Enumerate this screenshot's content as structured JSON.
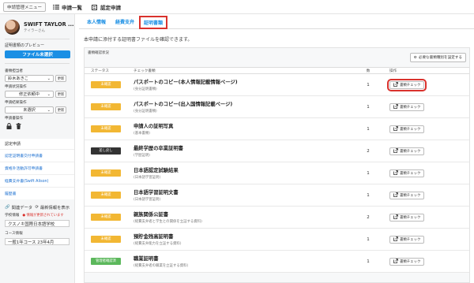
{
  "topbar": {
    "menu_button": "申請管理メニュー",
    "nav": [
      "申請一覧",
      "認定申請"
    ]
  },
  "sidebar": {
    "profile": {
      "name": "SWIFT TAYLOR ...",
      "subname": "テイラーさん"
    },
    "preview_title": "証明書類のプレビュー",
    "file_select_button": "ファイル未選択",
    "fields": [
      {
        "label": "書類担当者",
        "value": "鈴木あきこ",
        "update": "更新"
      },
      {
        "label": "申請状況操作",
        "value": "修正依頼中",
        "update": "更新"
      },
      {
        "label": "申請結果操作",
        "value": "未選択",
        "update": "更新"
      }
    ],
    "doc_ops_label": "申請書操作",
    "links_header": "認定申請",
    "links": [
      "認定証明書交付申請書",
      "資格外活動許可申請書",
      "経費支弁書(Swift Alison)",
      "履歴書"
    ],
    "actions": {
      "related": "関連データ",
      "latest_info": "最新情報を表示"
    },
    "school": {
      "label": "学校情報",
      "notice": "情報が更新されています",
      "value": "クスノキ国際日本語学校"
    },
    "course": {
      "label": "コース情報",
      "value": "一般1年コース 23年4月"
    }
  },
  "main": {
    "tabs": [
      "本人情報",
      "経費支弁",
      "証明書類"
    ],
    "active_tab": 2,
    "description": "本申請に添付する証明書ファイルを確認できます。",
    "panel_title": "書類確認状況",
    "settings_button": "必要な書類種別を設定する",
    "table": {
      "headers": [
        "ステータス",
        "チェック書類",
        "数",
        "操作"
      ],
      "check_label": "書類チェック",
      "rows": [
        {
          "status": "未確認",
          "status_color": "#f2b733",
          "title": "パスポートのコピー(本人情報記載情報ページ)",
          "sub": "(身分証明書類)",
          "count": "1"
        },
        {
          "status": "未確認",
          "status_color": "#f2b733",
          "title": "パスポートのコピー(出入国情報記載ページ)",
          "sub": "(身分証明書類)",
          "count": "1"
        },
        {
          "status": "未確認",
          "status_color": "#f2b733",
          "title": "申請人の証明写真",
          "sub": "(基本書類)",
          "count": "1"
        },
        {
          "status": "差し戻し",
          "status_color": "#333333",
          "title": "最終学歴の卒業証明書",
          "sub": "(学歴証明)",
          "count": "2"
        },
        {
          "status": "未確認",
          "status_color": "#f2b733",
          "title": "日本語認定試験結果",
          "sub": "(日本語学習証明)",
          "count": "1"
        },
        {
          "status": "未確認",
          "status_color": "#f2b733",
          "title": "日本語学習証明文書",
          "sub": "(日本語学習証明)",
          "count": "1"
        },
        {
          "status": "未確認",
          "status_color": "#f2b733",
          "title": "親族関係公証書",
          "sub": "(経費支弁者と学生との関係を立証する資料)",
          "count": "2"
        },
        {
          "status": "未確認",
          "status_color": "#f2b733",
          "title": "預貯金残高証明書",
          "sub": "(経費支弁能力を立証する資料)",
          "count": "1"
        },
        {
          "status": "管理者確認済",
          "status_color": "#5cb85c",
          "title": "職業証明書",
          "sub": "(経費支弁者の職業を立証する資料)",
          "count": "1"
        }
      ]
    }
  }
}
